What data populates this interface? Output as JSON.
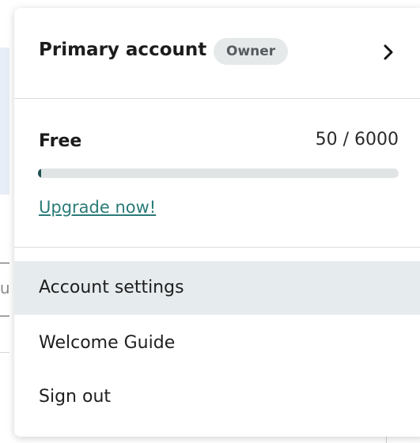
{
  "account": {
    "name": "Primary account",
    "role_badge": "Owner",
    "chevron_icon": "chevron-right-icon"
  },
  "plan": {
    "name": "Free",
    "usage_text": "50 / 6000",
    "usage_used": 50,
    "usage_limit": 6000,
    "progress_fraction": 0.0083,
    "upgrade_label": "Upgrade now!"
  },
  "menu": {
    "items": [
      {
        "label": "Account settings",
        "active": true
      },
      {
        "label": "Welcome Guide",
        "active": false
      },
      {
        "label": "Sign out",
        "active": false
      }
    ]
  },
  "background": {
    "partial_text": "tu"
  },
  "colors": {
    "accent": "#2a7b78",
    "progress_fill": "#1f4f52",
    "active_item_bg": "#e6ecee",
    "badge_bg": "#e6e9ea"
  }
}
